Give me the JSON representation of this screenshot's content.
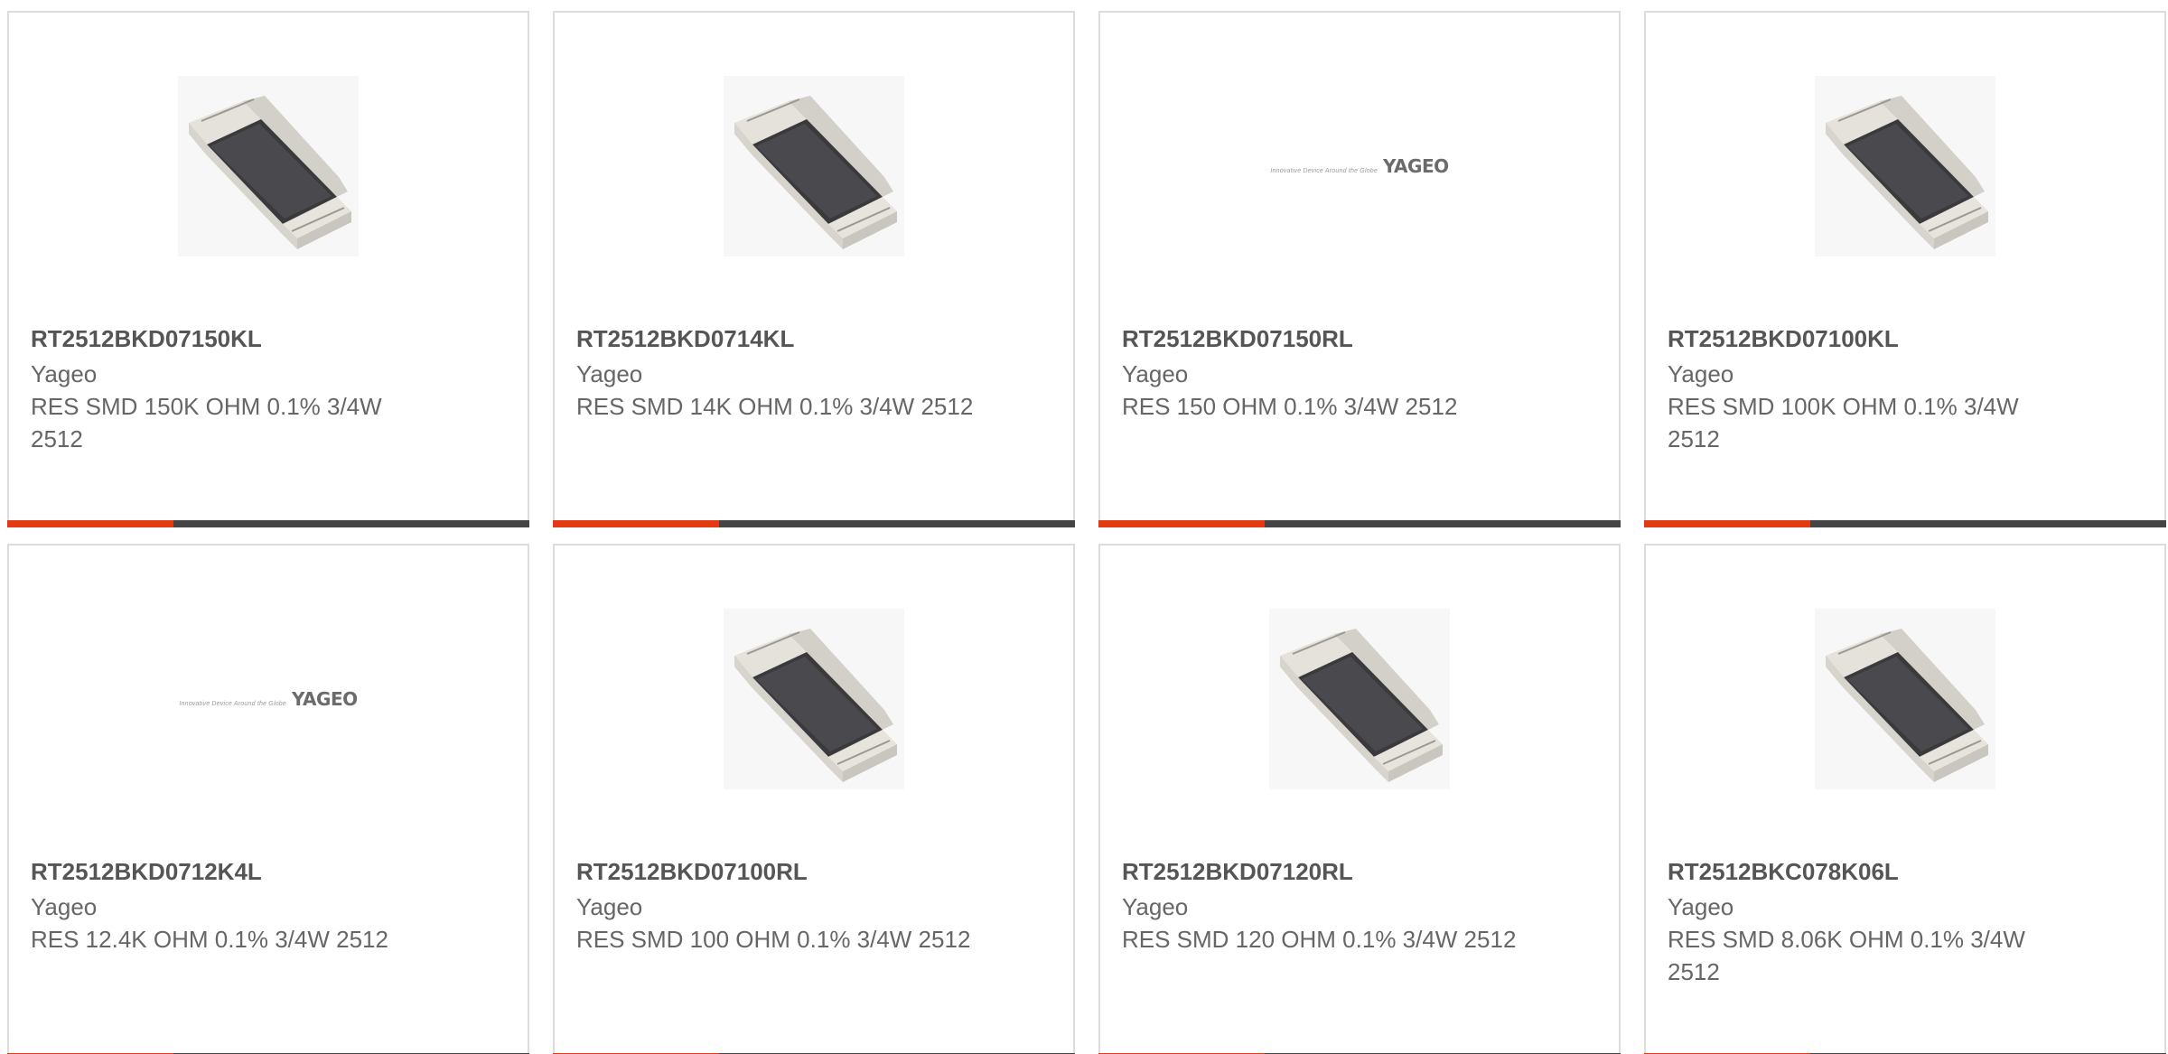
{
  "products": [
    {
      "part_number": "RT2512BKD07150KL",
      "manufacturer": "Yageo",
      "description": "RES SMD 150K OHM 0.1% 3/4W 2512",
      "image": "resistor-chip"
    },
    {
      "part_number": "RT2512BKD0714KL",
      "manufacturer": "Yageo",
      "description": "RES SMD 14K OHM 0.1% 3/4W 2512",
      "image": "resistor-chip"
    },
    {
      "part_number": "RT2512BKD07150RL",
      "manufacturer": "Yageo",
      "description": "RES 150 OHM 0.1% 3/4W 2512",
      "image": "yageo-logo"
    },
    {
      "part_number": "RT2512BKD07100KL",
      "manufacturer": "Yageo",
      "description": "RES SMD 100K OHM 0.1% 3/4W 2512",
      "image": "resistor-chip"
    },
    {
      "part_number": "RT2512BKD0712K4L",
      "manufacturer": "Yageo",
      "description": "RES 12.4K OHM 0.1% 3/4W 2512",
      "image": "yageo-logo"
    },
    {
      "part_number": "RT2512BKD07100RL",
      "manufacturer": "Yageo",
      "description": "RES SMD 100 OHM 0.1% 3/4W 2512",
      "image": "resistor-chip"
    },
    {
      "part_number": "RT2512BKD07120RL",
      "manufacturer": "Yageo",
      "description": "RES SMD 120 OHM 0.1% 3/4W 2512",
      "image": "resistor-chip"
    },
    {
      "part_number": "RT2512BKC078K06L",
      "manufacturer": "Yageo",
      "description": "RES SMD 8.06K OHM 0.1% 3/4W 2512",
      "image": "resistor-chip"
    }
  ],
  "logo": {
    "tagline": "Innovative Device Around the Globe",
    "brand": "YAGEO"
  },
  "colors": {
    "accent": "#e23a12",
    "bar": "#444444",
    "border": "#dcdcdc"
  }
}
